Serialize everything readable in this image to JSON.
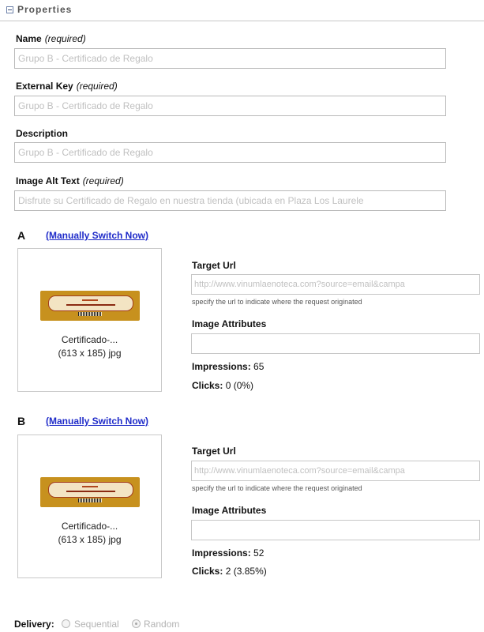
{
  "section": {
    "title": "Properties"
  },
  "fields": {
    "name": {
      "label": "Name",
      "required": "(required)",
      "value": "Grupo B - Certificado de Regalo"
    },
    "external_key": {
      "label": "External Key",
      "required": "(required)",
      "value": "Grupo B - Certificado de Regalo"
    },
    "description": {
      "label": "Description",
      "value": "Grupo B - Certificado de Regalo"
    },
    "image_alt_text": {
      "label": "Image Alt Text",
      "required": "(required)",
      "value": "Disfrute su Certificado de Regalo en nuestra tienda (ubicada en Plaza Los Laurele"
    }
  },
  "variants": [
    {
      "letter": "A",
      "switch_link": "(Manually Switch Now)",
      "image_name": "Certificado-...",
      "image_meta": "(613 x 185) jpg",
      "target_url_label": "Target Url",
      "target_url_value": "http://www.vinumlaenoteca.com?source=email&campa",
      "help_text": "specify the url to indicate where the request originated",
      "image_attributes_label": "Image Attributes",
      "image_attributes_value": "",
      "impressions_label": "Impressions:",
      "impressions_value": "65",
      "clicks_label": "Clicks:",
      "clicks_value": "0 (0%)"
    },
    {
      "letter": "B",
      "switch_link": "(Manually Switch Now)",
      "image_name": "Certificado-...",
      "image_meta": "(613 x 185) jpg",
      "target_url_label": "Target Url",
      "target_url_value": "http://www.vinumlaenoteca.com?source=email&campa",
      "help_text": "specify the url to indicate where the request originated",
      "image_attributes_label": "Image Attributes",
      "image_attributes_value": "",
      "impressions_label": "Impressions:",
      "impressions_value": "52",
      "clicks_label": "Clicks:",
      "clicks_value": "2 (3.85%)"
    }
  ],
  "delivery": {
    "label": "Delivery:",
    "options": [
      {
        "label": "Sequential",
        "selected": false
      },
      {
        "label": "Random",
        "selected": true
      }
    ]
  },
  "colors": {
    "link": "#1f2bc9",
    "placeholder_text": "#c0c0c0",
    "thumbnail_gold": "#c7911e"
  }
}
